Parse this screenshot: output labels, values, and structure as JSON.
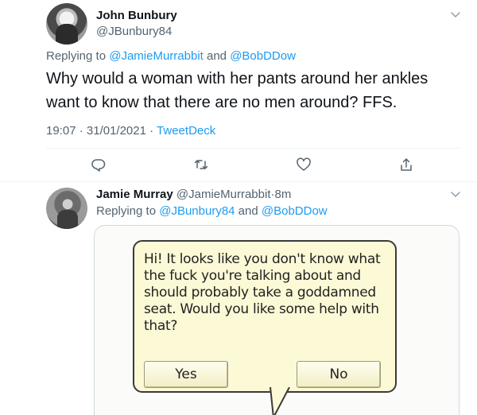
{
  "main_tweet": {
    "author_name": "John Bunbury",
    "author_handle": "@JBunbury84",
    "replying_prefix": "Replying to",
    "replying_user_1": "@JamieMurrabbit",
    "replying_and": "and",
    "replying_user_2": "@BobDDow",
    "text": "Why would a woman with her pants around her ankles want to know that there are no men around?  FFS.",
    "time": "19:07",
    "date": "31/01/2021",
    "separator": "·",
    "source": "TweetDeck"
  },
  "reply_tweet": {
    "author_name": "Jamie Murray",
    "author_handle": "@JamieMurrabbit",
    "separator": "·",
    "time_ago": "8m",
    "replying_prefix": "Replying to",
    "replying_user_1": "@JBunbury84",
    "replying_and": "and",
    "replying_user_2": "@BobDDow"
  },
  "meme": {
    "text": "Hi! It looks like you don't know what the fuck you're talking about and should probably take a goddamned seat. Would you like some help with that?",
    "yes_label": "Yes",
    "no_label": "No"
  },
  "colors": {
    "link": "#1d9bf0",
    "secondary_text": "#536471",
    "bubble_fill": "#fcf9d6"
  },
  "icons": {
    "caret": "chevron-down-icon",
    "reply": "reply-icon",
    "retweet": "retweet-icon",
    "like": "heart-icon",
    "share": "share-icon"
  }
}
